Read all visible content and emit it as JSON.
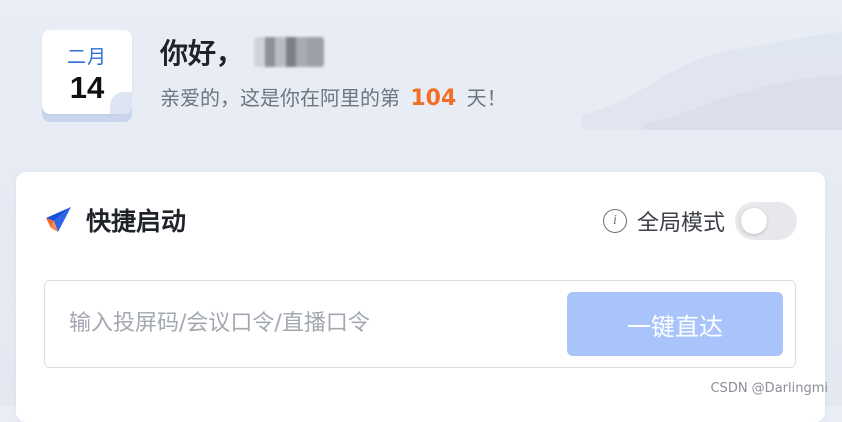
{
  "calendar": {
    "month": "二月",
    "day": "14"
  },
  "greeting": {
    "hello": "你好，",
    "sub_prefix": "亲爱的，这是你在阿里的第",
    "days": "104",
    "sub_suffix": "天！"
  },
  "quick_start": {
    "title": "快捷启动",
    "icon": "rocket-icon",
    "mode_label": "全局模式",
    "mode_enabled": false,
    "input_placeholder": "输入投屏码/会议口令/直播口令",
    "input_value": "",
    "button_label": "一键直达"
  },
  "watermark": "CSDN @Darlingmi",
  "colors": {
    "accent_blue": "#2f6fd6",
    "days_orange": "#f07028",
    "button_disabled_blue": "#a8c4fb",
    "rocket_blue": "#1a4fd9",
    "rocket_orange": "#f26b2f"
  }
}
